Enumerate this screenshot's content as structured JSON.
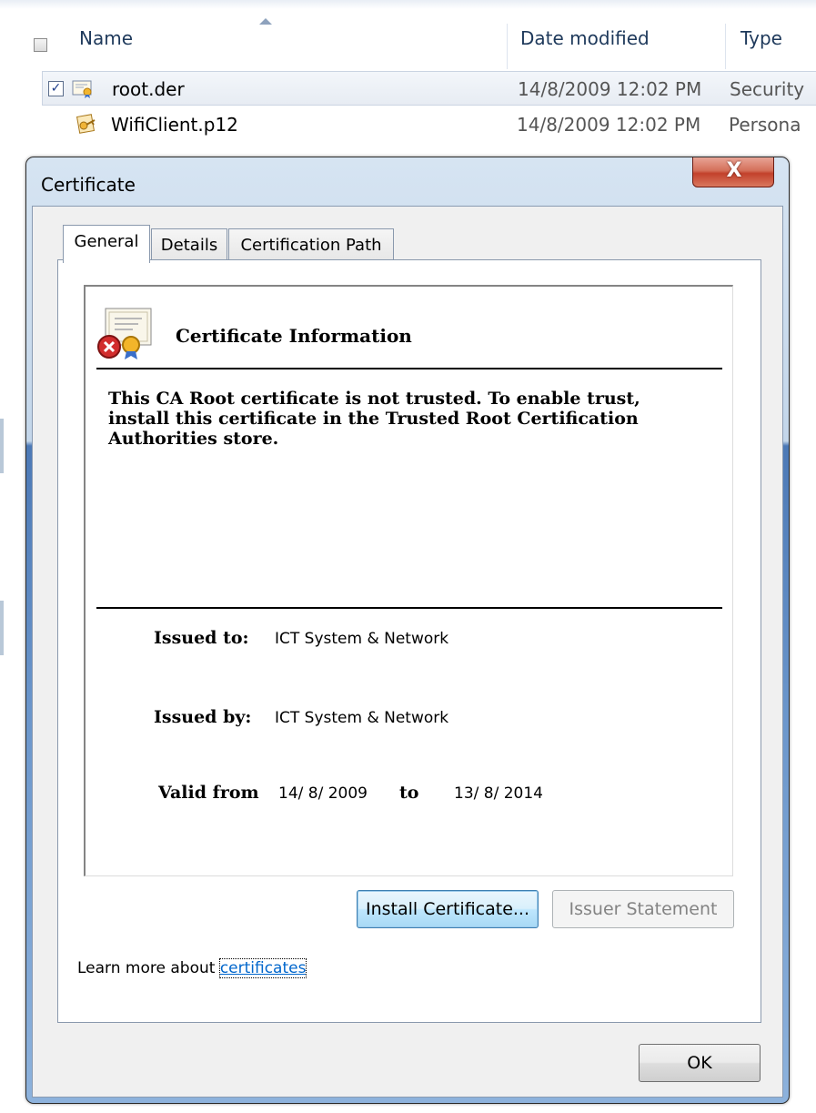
{
  "explorer": {
    "columns": {
      "name": "Name",
      "date_modified": "Date modified",
      "type": "Type"
    },
    "files": [
      {
        "name": "root.der",
        "date": "14/8/2009 12:02 PM",
        "type": "Security",
        "checked": true,
        "selected": true,
        "icon": "certificate-file-icon"
      },
      {
        "name": "WifiClient.p12",
        "date": "14/8/2009 12:02 PM",
        "type": "Persona",
        "checked": false,
        "selected": false,
        "icon": "pfx-file-icon"
      }
    ]
  },
  "dialog": {
    "title": "Certificate",
    "close_label": "X",
    "tabs": [
      {
        "label": "General",
        "active": true
      },
      {
        "label": "Details",
        "active": false
      },
      {
        "label": "Certification Path",
        "active": false
      }
    ],
    "info": {
      "heading": "Certificate Information",
      "warning": "This CA Root certificate is not trusted. To enable trust, install this certificate in the Trusted Root Certification Authorities store.",
      "issued_to_label": "Issued to:",
      "issued_to": "ICT System & Network",
      "issued_by_label": "Issued by:",
      "issued_by": "ICT System & Network",
      "valid_from_label": "Valid from",
      "valid_from": "14/ 8/ 2009",
      "valid_to_label": "to",
      "valid_to": "13/ 8/ 2014"
    },
    "buttons": {
      "install": "Install Certificate...",
      "issuer_statement": "Issuer Statement",
      "ok": "OK"
    },
    "learn_more_prefix": "Learn more about ",
    "learn_more_link": "certificates"
  },
  "colors": {
    "link": "#0066cc",
    "close_button": "#c2412b",
    "frame": "#6c97cc"
  }
}
